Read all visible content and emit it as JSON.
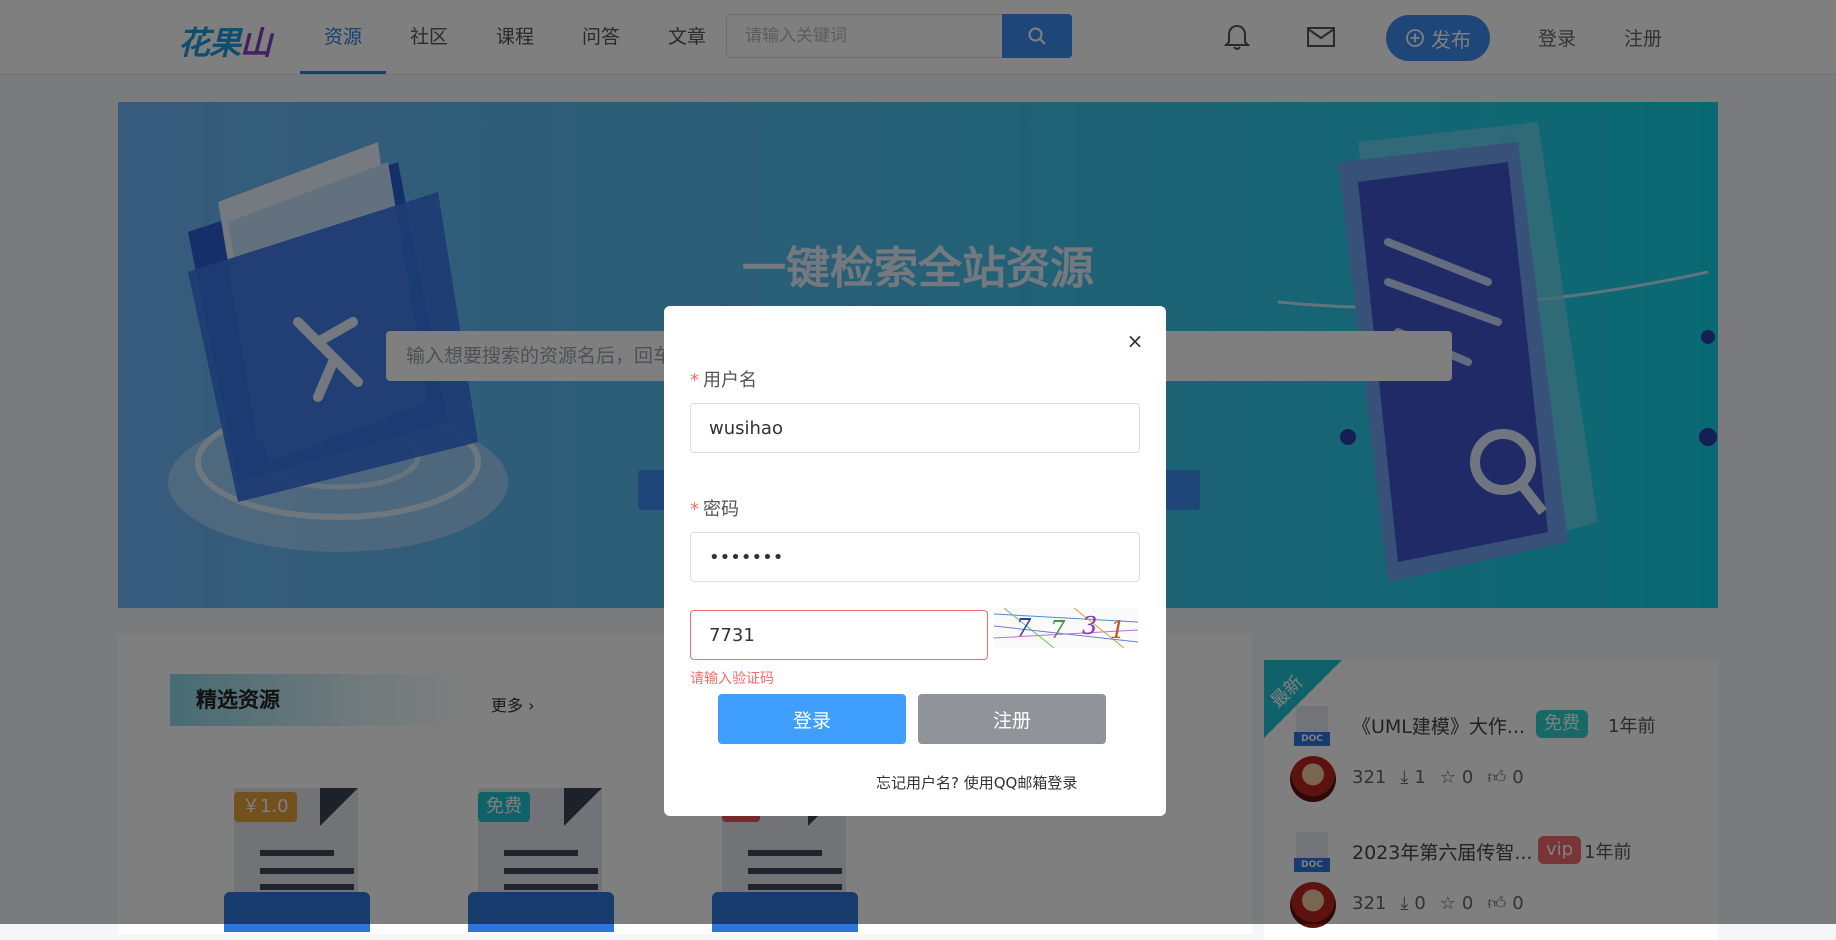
{
  "header": {
    "logo_part1": "花果",
    "logo_part2": "山",
    "nav": [
      "资源",
      "社区",
      "课程",
      "问答",
      "文章"
    ],
    "search_placeholder": "请输入关键词",
    "publish_label": "发布",
    "login_label": "登录",
    "register_label": "注册"
  },
  "banner": {
    "title": "一键检索全站资源",
    "search_placeholder": "输入想要搜索的资源名后，回车"
  },
  "featured": {
    "title": "精选资源",
    "more_label": "更多",
    "tiles": [
      {
        "tag": "￥1.0",
        "color": "#e6a23c"
      },
      {
        "tag": "免费",
        "color": "#20c5d4"
      },
      {
        "tag": "",
        "color": "#e45656"
      }
    ]
  },
  "side": {
    "ribbon": "最新",
    "doc_label": "DOC",
    "items": [
      {
        "title": "《UML建模》大作...",
        "pill": "免费",
        "pill_color": "#2fd2cf",
        "time": "1年前",
        "user": "321",
        "downloads": "1",
        "stars": "0",
        "likes": "0"
      },
      {
        "title": "2023年第六届传智...",
        "pill": "vip",
        "pill_color": "#f06a6a",
        "time": "1年前",
        "user": "321",
        "downloads": "0",
        "stars": "0",
        "likes": "0"
      }
    ]
  },
  "modal": {
    "close_icon": "×",
    "username_label": "用户名",
    "username_value": "wusihao",
    "password_label": "密码",
    "password_value": "•••••••",
    "captcha_value": "7731",
    "captcha_error": "请输入验证码",
    "login_button": "登录",
    "register_button": "注册",
    "forgot_text": "忘记用户名?",
    "qq_login_text": "使用QQ邮箱登录"
  }
}
